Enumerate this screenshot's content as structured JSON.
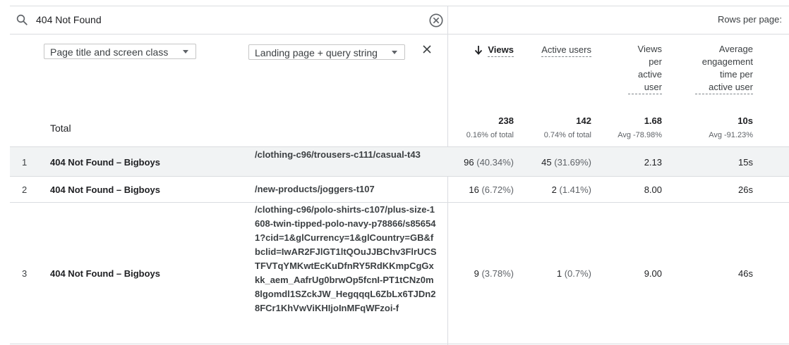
{
  "search": {
    "value": "404 Not Found",
    "rows_per_page_label": "Rows per page:"
  },
  "dimensions": {
    "primary": "Page title and screen class",
    "secondary": "Landing page + query string"
  },
  "columns": [
    {
      "label": "Views"
    },
    {
      "label": "Active users"
    },
    {
      "label": "Views per active user"
    },
    {
      "label": "Average engagement time per active user"
    }
  ],
  "total": {
    "label": "Total",
    "views": "238",
    "views_sub": "0.16% of total",
    "users": "142",
    "users_sub": "0.74% of total",
    "vpu": "1.68",
    "vpu_sub": "Avg -78.98%",
    "time": "10s",
    "time_sub": "Avg -91.23%"
  },
  "rows": [
    {
      "num": "1",
      "title": "404 Not Found – Bigboys",
      "landing": "/clothing-c96/trousers-c111/casual-t43",
      "views": "96",
      "views_pct": "(40.34%)",
      "users": "45",
      "users_pct": "(31.69%)",
      "vpu": "2.13",
      "time": "15s"
    },
    {
      "num": "2",
      "title": "404 Not Found – Bigboys",
      "landing": "/new-products/joggers-t107",
      "views": "16",
      "views_pct": "(6.72%)",
      "users": "2",
      "users_pct": "(1.41%)",
      "vpu": "8.00",
      "time": "26s"
    },
    {
      "num": "3",
      "title": "404 Not Found – Bigboys",
      "landing": "/clothing-c96/polo-shirts-c107/plus-size-1608-twin-tipped-polo-navy-p78866/s856541?cid=1&glCurrency=1&glCountry=GB&fbclid=IwAR2FJlGT1ltQOuJJBChv3FlrUCSTFVTqYMKwtEcKuDfnRY5RdKKmpCgGxkk_aem_AafrUg0brwOp5fcnI-PT1tCNz0m8lgomdl1SZckJW_HegqqqL6ZbLx6TJDn28FCr1KhVwViKHIjoInMFqWFzoi-f",
      "views": "9",
      "views_pct": "(3.78%)",
      "users": "1",
      "users_pct": "(0.7%)",
      "vpu": "9.00",
      "time": "46s"
    }
  ],
  "colors": {
    "border": "#dadce0",
    "row_shade": "#f1f3f4",
    "text": "#202124",
    "muted": "#5f6368"
  }
}
